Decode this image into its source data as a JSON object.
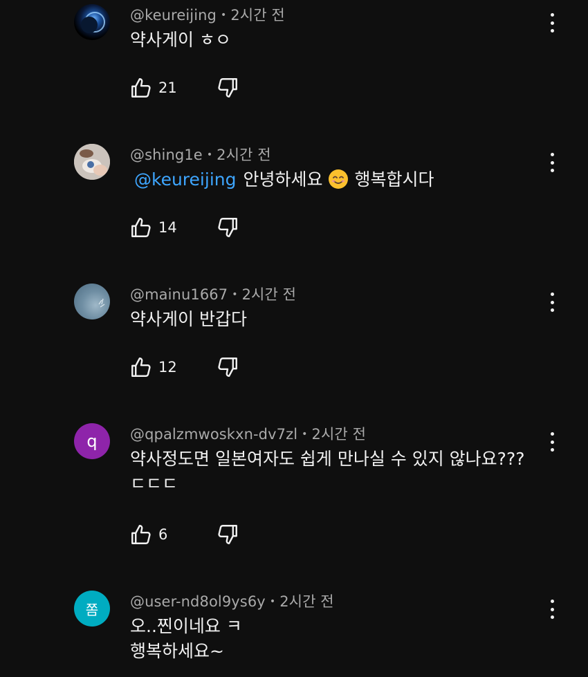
{
  "comments": [
    {
      "author": "@keureijing",
      "time": "2시간 전",
      "text": "약사게이 ㅎㅇ",
      "likes": "21",
      "avatar_icon": "night-sky-photo"
    },
    {
      "author": "@shing1e",
      "time": "2시간 전",
      "mention": "@keureijing",
      "text_before_emoji": "안녕하세요",
      "text_after_emoji": "행복합시다",
      "emoji": "smiling-face-emoji",
      "likes": "14",
      "avatar_icon": "photo-avatar"
    },
    {
      "author": "@mainu1667",
      "time": "2시간 전",
      "text": "약사게이 반갑다",
      "likes": "12",
      "avatar_icon": "sky-photo"
    },
    {
      "author": "@qpalzmwoskxn-dv7zl",
      "time": "2시간 전",
      "text_line1": "약사정도면 일본여자도 쉽게 만나실 수 있지 않나요???",
      "text_line2": "ㄷㄷㄷ",
      "likes": "6",
      "avatar_letter": "q",
      "avatar_color": "#8e24aa"
    },
    {
      "author": "@user-nd8ol9ys6y",
      "time": "2시간 전",
      "text_line1": "오..찐이네요 ㅋ",
      "text_line2": "행복하세요~",
      "avatar_letter": "쫌",
      "avatar_color": "#00acc1"
    }
  ],
  "separator": "•",
  "colors": {
    "background": "#0f0f0f",
    "text": "#f1f1f1",
    "meta": "#aaaaaa",
    "mention": "#3ea6ff"
  }
}
